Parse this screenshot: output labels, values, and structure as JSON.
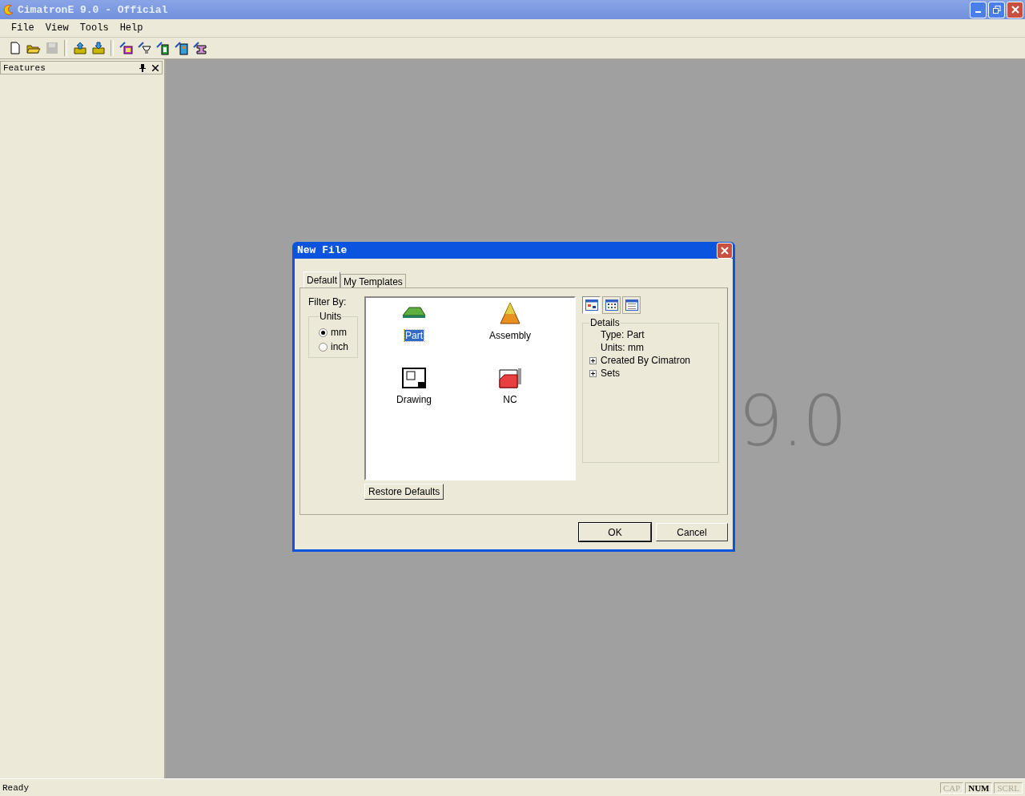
{
  "window": {
    "title": "CimatronE 9.0 - Official"
  },
  "menu": [
    "File",
    "View",
    "Tools",
    "Help"
  ],
  "toolbar": [
    {
      "kind": "new",
      "disabled": false
    },
    {
      "kind": "open",
      "disabled": false
    },
    {
      "kind": "save",
      "disabled": true
    },
    {
      "kind": "sep"
    },
    {
      "kind": "import",
      "disabled": false
    },
    {
      "kind": "export",
      "disabled": false
    },
    {
      "kind": "sep"
    },
    {
      "kind": "tool-a",
      "disabled": false
    },
    {
      "kind": "tool-b",
      "disabled": false
    },
    {
      "kind": "tool-c",
      "disabled": false
    },
    {
      "kind": "tool-d",
      "disabled": false
    },
    {
      "kind": "tool-e",
      "disabled": false
    }
  ],
  "features_panel": {
    "title": "Features"
  },
  "background_logo": "9.0",
  "dialog": {
    "title": "New File",
    "tabs": [
      {
        "label": "Default",
        "selected": true
      },
      {
        "label": "My Templates",
        "selected": false
      }
    ],
    "filter_label": "Filter By:",
    "units": {
      "title": "Units",
      "options": [
        {
          "label": "mm",
          "selected": true
        },
        {
          "label": "inch",
          "selected": false
        }
      ]
    },
    "templates": [
      {
        "label": "Part",
        "kind": "part",
        "selected": true
      },
      {
        "label": "Assembly",
        "kind": "assembly",
        "selected": false
      },
      {
        "label": "Drawing",
        "kind": "drawing",
        "selected": false
      },
      {
        "label": "NC",
        "kind": "nc",
        "selected": false
      }
    ],
    "view_buttons": [
      {
        "kind": "large",
        "selected": true
      },
      {
        "kind": "small",
        "selected": false
      },
      {
        "kind": "details",
        "selected": false
      }
    ],
    "details": {
      "title": "Details",
      "items": [
        {
          "label": "Type: Part",
          "kind": "text"
        },
        {
          "label": "Units: mm",
          "kind": "text"
        },
        {
          "label": "Created By Cimatron",
          "kind": "expandable",
          "expanded": false
        },
        {
          "label": "Sets",
          "kind": "expandable",
          "expanded": false
        }
      ]
    },
    "restore_button": "Restore Defaults",
    "buttons": [
      {
        "label": "OK",
        "default": true
      },
      {
        "label": "Cancel",
        "default": false
      }
    ]
  },
  "status_bar": {
    "text": "Ready",
    "indicators": [
      {
        "label": "CAP",
        "on": false
      },
      {
        "label": "NUM",
        "on": true
      },
      {
        "label": "SCRL",
        "on": false
      }
    ]
  }
}
